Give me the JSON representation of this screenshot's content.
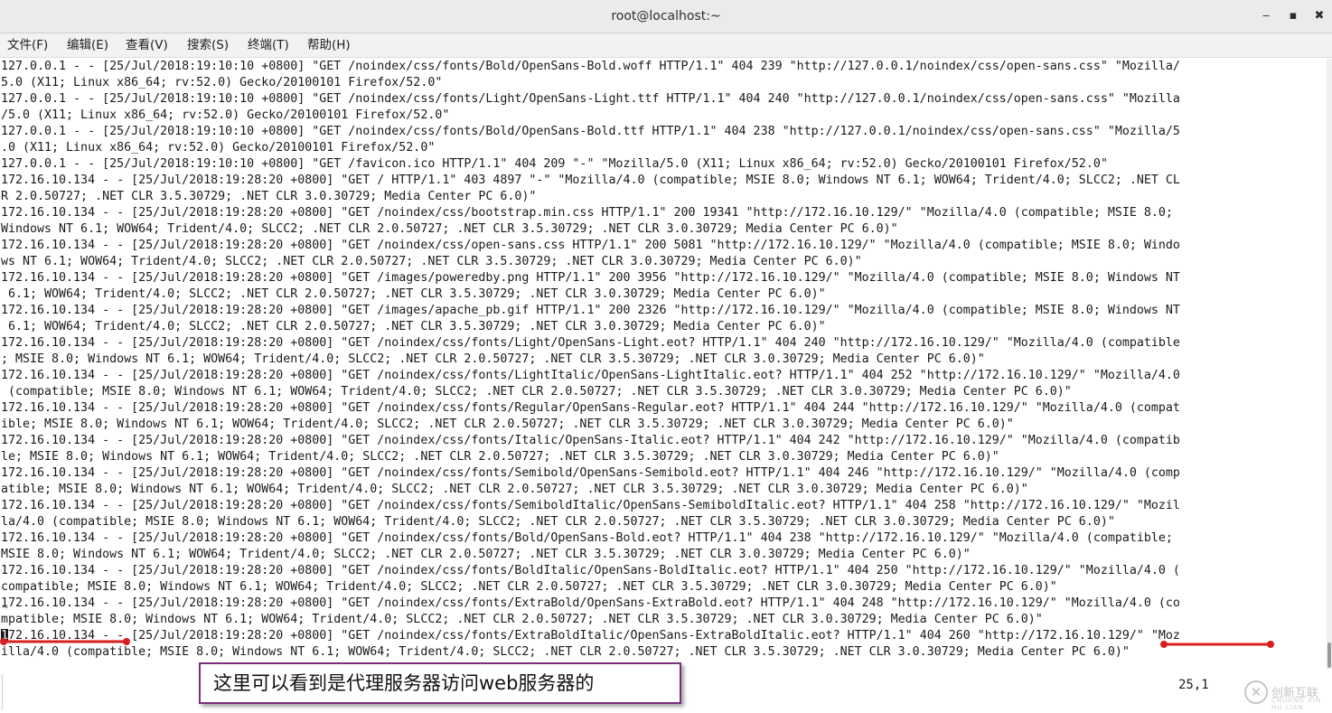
{
  "window": {
    "title": "root@localhost:~",
    "minimize_glyph": "‒",
    "maximize_glyph": "▪",
    "close_glyph": "✖"
  },
  "menu": [
    "文件(F)",
    "编辑(E)",
    "查看(V)",
    "搜索(S)",
    "终端(T)",
    "帮助(H)"
  ],
  "terminal": {
    "lines": [
      "127.0.0.1 - - [25/Jul/2018:19:10:10 +0800] \"GET /noindex/css/fonts/Bold/OpenSans-Bold.woff HTTP/1.1\" 404 239 \"http://127.0.0.1/noindex/css/open-sans.css\" \"Mozilla/",
      "5.0 (X11; Linux x86_64; rv:52.0) Gecko/20100101 Firefox/52.0\"",
      "127.0.0.1 - - [25/Jul/2018:19:10:10 +0800] \"GET /noindex/css/fonts/Light/OpenSans-Light.ttf HTTP/1.1\" 404 240 \"http://127.0.0.1/noindex/css/open-sans.css\" \"Mozilla",
      "/5.0 (X11; Linux x86_64; rv:52.0) Gecko/20100101 Firefox/52.0\"",
      "127.0.0.1 - - [25/Jul/2018:19:10:10 +0800] \"GET /noindex/css/fonts/Bold/OpenSans-Bold.ttf HTTP/1.1\" 404 238 \"http://127.0.0.1/noindex/css/open-sans.css\" \"Mozilla/5",
      ".0 (X11; Linux x86_64; rv:52.0) Gecko/20100101 Firefox/52.0\"",
      "127.0.0.1 - - [25/Jul/2018:19:10:10 +0800] \"GET /favicon.ico HTTP/1.1\" 404 209 \"-\" \"Mozilla/5.0 (X11; Linux x86_64; rv:52.0) Gecko/20100101 Firefox/52.0\"",
      "172.16.10.134 - - [25/Jul/2018:19:28:20 +0800] \"GET / HTTP/1.1\" 403 4897 \"-\" \"Mozilla/4.0 (compatible; MSIE 8.0; Windows NT 6.1; WOW64; Trident/4.0; SLCC2; .NET CL",
      "R 2.0.50727; .NET CLR 3.5.30729; .NET CLR 3.0.30729; Media Center PC 6.0)\"",
      "172.16.10.134 - - [25/Jul/2018:19:28:20 +0800] \"GET /noindex/css/bootstrap.min.css HTTP/1.1\" 200 19341 \"http://172.16.10.129/\" \"Mozilla/4.0 (compatible; MSIE 8.0;",
      "Windows NT 6.1; WOW64; Trident/4.0; SLCC2; .NET CLR 2.0.50727; .NET CLR 3.5.30729; .NET CLR 3.0.30729; Media Center PC 6.0)\"",
      "172.16.10.134 - - [25/Jul/2018:19:28:20 +0800] \"GET /noindex/css/open-sans.css HTTP/1.1\" 200 5081 \"http://172.16.10.129/\" \"Mozilla/4.0 (compatible; MSIE 8.0; Windo",
      "ws NT 6.1; WOW64; Trident/4.0; SLCC2; .NET CLR 2.0.50727; .NET CLR 3.5.30729; .NET CLR 3.0.30729; Media Center PC 6.0)\"",
      "172.16.10.134 - - [25/Jul/2018:19:28:20 +0800] \"GET /images/poweredby.png HTTP/1.1\" 200 3956 \"http://172.16.10.129/\" \"Mozilla/4.0 (compatible; MSIE 8.0; Windows NT",
      " 6.1; WOW64; Trident/4.0; SLCC2; .NET CLR 2.0.50727; .NET CLR 3.5.30729; .NET CLR 3.0.30729; Media Center PC 6.0)\"",
      "172.16.10.134 - - [25/Jul/2018:19:28:20 +0800] \"GET /images/apache_pb.gif HTTP/1.1\" 200 2326 \"http://172.16.10.129/\" \"Mozilla/4.0 (compatible; MSIE 8.0; Windows NT",
      " 6.1; WOW64; Trident/4.0; SLCC2; .NET CLR 2.0.50727; .NET CLR 3.5.30729; .NET CLR 3.0.30729; Media Center PC 6.0)\"",
      "172.16.10.134 - - [25/Jul/2018:19:28:20 +0800] \"GET /noindex/css/fonts/Light/OpenSans-Light.eot? HTTP/1.1\" 404 240 \"http://172.16.10.129/\" \"Mozilla/4.0 (compatible",
      "; MSIE 8.0; Windows NT 6.1; WOW64; Trident/4.0; SLCC2; .NET CLR 2.0.50727; .NET CLR 3.5.30729; .NET CLR 3.0.30729; Media Center PC 6.0)\"",
      "172.16.10.134 - - [25/Jul/2018:19:28:20 +0800] \"GET /noindex/css/fonts/LightItalic/OpenSans-LightItalic.eot? HTTP/1.1\" 404 252 \"http://172.16.10.129/\" \"Mozilla/4.0",
      " (compatible; MSIE 8.0; Windows NT 6.1; WOW64; Trident/4.0; SLCC2; .NET CLR 2.0.50727; .NET CLR 3.5.30729; .NET CLR 3.0.30729; Media Center PC 6.0)\"",
      "172.16.10.134 - - [25/Jul/2018:19:28:20 +0800] \"GET /noindex/css/fonts/Regular/OpenSans-Regular.eot? HTTP/1.1\" 404 244 \"http://172.16.10.129/\" \"Mozilla/4.0 (compat",
      "ible; MSIE 8.0; Windows NT 6.1; WOW64; Trident/4.0; SLCC2; .NET CLR 2.0.50727; .NET CLR 3.5.30729; .NET CLR 3.0.30729; Media Center PC 6.0)\"",
      "172.16.10.134 - - [25/Jul/2018:19:28:20 +0800] \"GET /noindex/css/fonts/Italic/OpenSans-Italic.eot? HTTP/1.1\" 404 242 \"http://172.16.10.129/\" \"Mozilla/4.0 (compatib",
      "le; MSIE 8.0; Windows NT 6.1; WOW64; Trident/4.0; SLCC2; .NET CLR 2.0.50727; .NET CLR 3.5.30729; .NET CLR 3.0.30729; Media Center PC 6.0)\"",
      "172.16.10.134 - - [25/Jul/2018:19:28:20 +0800] \"GET /noindex/css/fonts/Semibold/OpenSans-Semibold.eot? HTTP/1.1\" 404 246 \"http://172.16.10.129/\" \"Mozilla/4.0 (comp",
      "atible; MSIE 8.0; Windows NT 6.1; WOW64; Trident/4.0; SLCC2; .NET CLR 2.0.50727; .NET CLR 3.5.30729; .NET CLR 3.0.30729; Media Center PC 6.0)\"",
      "172.16.10.134 - - [25/Jul/2018:19:28:20 +0800] \"GET /noindex/css/fonts/SemiboldItalic/OpenSans-SemiboldItalic.eot? HTTP/1.1\" 404 258 \"http://172.16.10.129/\" \"Mozil",
      "la/4.0 (compatible; MSIE 8.0; Windows NT 6.1; WOW64; Trident/4.0; SLCC2; .NET CLR 2.0.50727; .NET CLR 3.5.30729; .NET CLR 3.0.30729; Media Center PC 6.0)\"",
      "172.16.10.134 - - [25/Jul/2018:19:28:20 +0800] \"GET /noindex/css/fonts/Bold/OpenSans-Bold.eot? HTTP/1.1\" 404 238 \"http://172.16.10.129/\" \"Mozilla/4.0 (compatible;",
      "MSIE 8.0; Windows NT 6.1; WOW64; Trident/4.0; SLCC2; .NET CLR 2.0.50727; .NET CLR 3.5.30729; .NET CLR 3.0.30729; Media Center PC 6.0)\"",
      "172.16.10.134 - - [25/Jul/2018:19:28:20 +0800] \"GET /noindex/css/fonts/BoldItalic/OpenSans-BoldItalic.eot? HTTP/1.1\" 404 250 \"http://172.16.10.129/\" \"Mozilla/4.0 (",
      "compatible; MSIE 8.0; Windows NT 6.1; WOW64; Trident/4.0; SLCC2; .NET CLR 2.0.50727; .NET CLR 3.5.30729; .NET CLR 3.0.30729; Media Center PC 6.0)\"",
      "172.16.10.134 - - [25/Jul/2018:19:28:20 +0800] \"GET /noindex/css/fonts/ExtraBold/OpenSans-ExtraBold.eot? HTTP/1.1\" 404 248 \"http://172.16.10.129/\" \"Mozilla/4.0 (co",
      "mpatible; MSIE 8.0; Windows NT 6.1; WOW64; Trident/4.0; SLCC2; .NET CLR 2.0.50727; .NET CLR 3.5.30729; .NET CLR 3.0.30729; Media Center PC 6.0)\"",
      "172.16.10.134 - - [25/Jul/2018:19:28:20 +0800] \"GET /noindex/css/fonts/ExtraBoldItalic/OpenSans-ExtraBoldItalic.eot? HTTP/1.1\" 404 260 \"http://172.16.10.129/\" \"Moz",
      "illa/4.0 (compatible; MSIE 8.0; Windows NT 6.1; WOW64; Trident/4.0; SLCC2; .NET CLR 2.0.50727; .NET CLR 3.5.30729; .NET CLR 3.0.30729; Media Center PC 6.0)\""
    ],
    "tilde": "~",
    "cursor_position": "25,1"
  },
  "annotation": {
    "text": "这里可以看到是代理服务器访问web服务器的",
    "color": "#d81e1e",
    "border_color": "#7a2c7a"
  },
  "watermark": {
    "icon": "chuangxin-logo-icon",
    "glyph": "✕",
    "text": "创新互联",
    "subtext": "CHUANG XIN HU LIAN"
  }
}
